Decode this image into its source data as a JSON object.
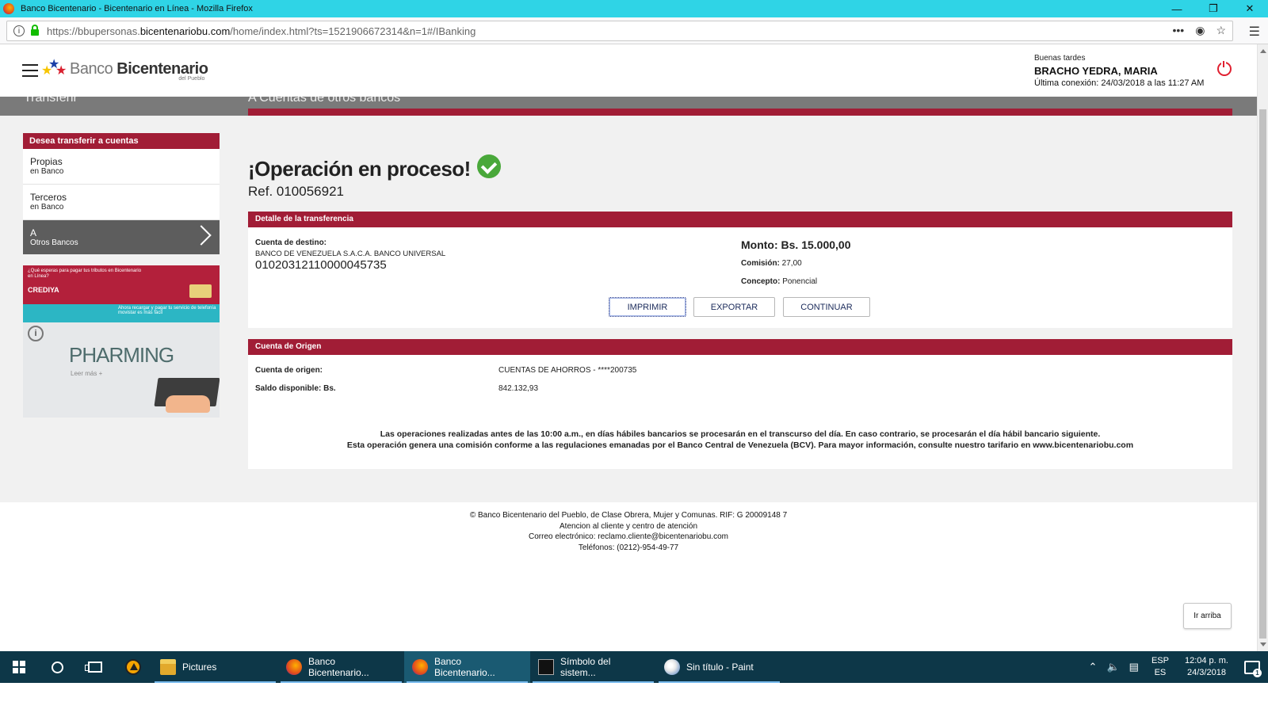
{
  "window": {
    "title": "Banco Bicentenario - Bicentenario en Línea - Mozilla Firefox",
    "url_prefix": "https://bbupersonas.",
    "url_domain": "bicentenariobu.com",
    "url_path": "/home/index.html?ts=1521906672314&n=1#/IBanking"
  },
  "header": {
    "logo_light": "Banco ",
    "logo_bold": "Bicentenario",
    "logo_sub": "del Pueblo",
    "greeting": "Buenas tardes",
    "user_name": "BRACHO YEDRA, MARIA",
    "last_login": "Última conexión: 24/03/2018 a las 11:27 AM"
  },
  "subnav": {
    "left": "Transferir",
    "right": "A Cuentas de otros bancos"
  },
  "sidemenu": {
    "title": "Desea transferir a cuentas",
    "items": [
      {
        "line1": "Propias",
        "line2": "en Banco"
      },
      {
        "line1": "Terceros",
        "line2": "en Banco"
      },
      {
        "line1": "A",
        "line2": "Otros Bancos"
      }
    ]
  },
  "banners": {
    "b1_text": "¿Qué esperas para pagar tus tributos en Bicentenario en Línea?",
    "b1_brand": "CREDIYA",
    "b1_bottom": "Ahora recargar y pagar tu servicio de telefonía movistar es más fácil",
    "b2_title": "PHARMING",
    "b2_link": "Leer más +"
  },
  "result": {
    "title": "¡Operación en proceso!",
    "ref": "Ref. 010056921"
  },
  "detail": {
    "header": "Detalle de la transferencia",
    "dest_label": "Cuenta de destino:",
    "dest_bank": "BANCO DE VENEZUELA S.A.C.A. BANCO UNIVERSAL",
    "dest_account": "01020312110000045735",
    "monto": "Monto: Bs. 15.000,00",
    "comision_label": "Comisión:",
    "comision_value": " 27,00",
    "concepto_label": "Concepto:",
    "concepto_value": " Ponencial",
    "btn_print": "IMPRIMIR",
    "btn_export": "EXPORTAR",
    "btn_continue": "CONTINUAR"
  },
  "origin": {
    "header": "Cuenta de Origen",
    "origin_label": "Cuenta de origen:",
    "origin_value": "CUENTAS DE AHORROS - ****200735",
    "saldo_label": "Saldo disponible: Bs.",
    "saldo_value": "842.132,93",
    "notice_1": "Las operaciones realizadas antes de las 10:00 a.m., en días hábiles bancarios se procesarán en el transcurso del día. En caso contrario, se procesarán el día hábil bancario siguiente.",
    "notice_2": "Esta operación genera una comisión conforme a las regulaciones emanadas por el Banco Central de Venezuela (BCV). Para mayor información, consulte nuestro tarifario en www.bicentenariobu.com"
  },
  "footer": {
    "line1": "© Banco Bicentenario del Pueblo, de Clase Obrera, Mujer y Comunas. RIF: G 20009148 7",
    "line2": "Atencion al cliente y centro de atención",
    "line3": "Correo electrónico: reclamo.cliente@bicentenariobu.com",
    "line4": "Teléfonos: (0212)-954-49-77",
    "back_to_top": "Ir arriba"
  },
  "taskbar": {
    "tasks": [
      {
        "label": "Pictures",
        "icon": "folder-icon"
      },
      {
        "label": "Banco Bicentenario...",
        "icon": "firefox-icon"
      },
      {
        "label": "Banco Bicentenario...",
        "icon": "firefox-icon"
      },
      {
        "label": "Símbolo del sistem...",
        "icon": "cmd-icon"
      },
      {
        "label": "Sin título - Paint",
        "icon": "paint-icon"
      }
    ],
    "lang_1": "ESP",
    "lang_2": "ES",
    "time": "12:04 p. m.",
    "date": "24/3/2018",
    "notif_count": "1"
  },
  "colors": {
    "accent_red": "#a11d36",
    "titlebar": "#2fd4e6",
    "taskbar": "#0d3748",
    "success": "#49a83a"
  }
}
